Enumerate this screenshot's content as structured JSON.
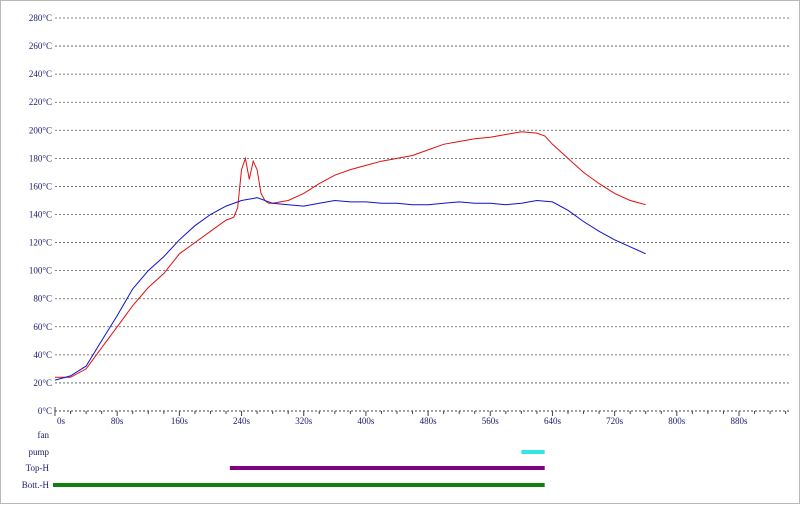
{
  "chart_data": {
    "type": "line",
    "title": "",
    "xlabel": "",
    "ylabel": "",
    "xlim": [
      0,
      880
    ],
    "ylim": [
      0,
      280
    ],
    "grid": true,
    "x_ticks": [
      "0s",
      "80s",
      "160s",
      "240s",
      "320s",
      "400s",
      "480s",
      "560s",
      "640s",
      "720s",
      "800s",
      "880s"
    ],
    "y_ticks": [
      "0°C",
      "20°C",
      "40°C",
      "60°C",
      "80°C",
      "100°C",
      "120°C",
      "140°C",
      "160°C",
      "180°C",
      "200°C",
      "220°C",
      "240°C",
      "260°C",
      "280°C"
    ],
    "colors": {
      "red_series": "#e01010",
      "blue_series": "#1010d0"
    },
    "series": [
      {
        "color": "#e01010",
        "x": [
          0,
          20,
          40,
          60,
          80,
          100,
          120,
          140,
          160,
          180,
          200,
          220,
          230,
          235,
          240,
          245,
          250,
          255,
          260,
          265,
          270,
          275,
          280,
          300,
          320,
          340,
          360,
          380,
          400,
          420,
          440,
          460,
          480,
          500,
          520,
          540,
          560,
          580,
          600,
          620,
          630,
          640,
          660,
          680,
          700,
          720,
          740,
          760
        ],
        "y": [
          24,
          24,
          30,
          45,
          60,
          75,
          88,
          98,
          112,
          120,
          128,
          136,
          138,
          145,
          172,
          180,
          165,
          178,
          172,
          155,
          150,
          148,
          148,
          150,
          155,
          162,
          168,
          172,
          175,
          178,
          180,
          182,
          186,
          190,
          192,
          194,
          195,
          197,
          199,
          198,
          196,
          190,
          180,
          170,
          162,
          155,
          150,
          147
        ]
      },
      {
        "color": "#1010d0",
        "x": [
          0,
          20,
          40,
          60,
          80,
          100,
          120,
          140,
          160,
          180,
          200,
          220,
          240,
          260,
          280,
          300,
          320,
          340,
          360,
          380,
          400,
          420,
          440,
          460,
          480,
          500,
          520,
          540,
          560,
          580,
          600,
          620,
          640,
          660,
          680,
          700,
          720,
          740,
          760
        ],
        "y": [
          22,
          25,
          32,
          50,
          68,
          87,
          100,
          110,
          122,
          132,
          140,
          146,
          150,
          152,
          148,
          147,
          146,
          148,
          150,
          149,
          149,
          148,
          148,
          147,
          147,
          148,
          149,
          148,
          148,
          147,
          148,
          150,
          149,
          143,
          135,
          128,
          122,
          117,
          112
        ]
      }
    ],
    "lanes": [
      {
        "label": "fan",
        "color": "",
        "spans": []
      },
      {
        "label": "pump",
        "color": "#33e6e6",
        "spans": [
          [
            600,
            630
          ]
        ]
      },
      {
        "label": "Top-H",
        "color": "#800080",
        "spans": [
          [
            225,
            630
          ]
        ]
      },
      {
        "label": "Bott.-H",
        "color": "#108010",
        "spans": [
          [
            0,
            630
          ]
        ]
      }
    ]
  }
}
